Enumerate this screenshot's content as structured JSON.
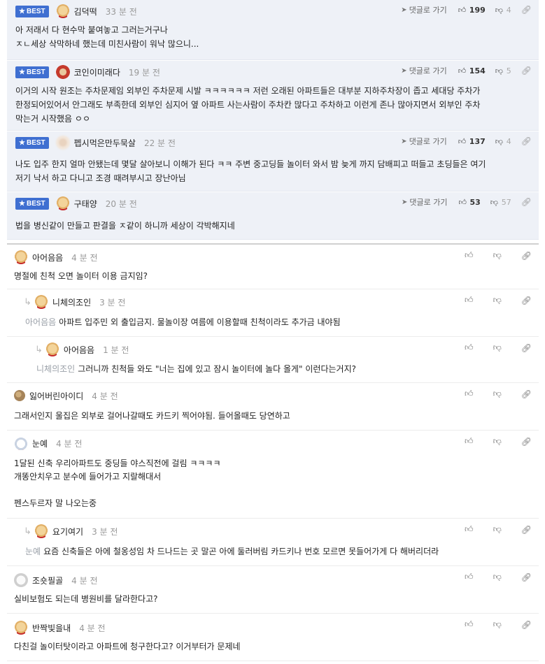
{
  "colors": {
    "best_bg": "#eef1f7",
    "badge": "#3f6fd1"
  },
  "labels": {
    "best": "BEST",
    "go_reply": "댓글로 가기"
  },
  "best_comments": [
    {
      "nick": "김덕떡",
      "time": "33 분 전",
      "likes": "199",
      "dislikes": "4",
      "avatar": "dog-icon",
      "lines": [
        "아 저래서 다 현수막 붙여놓고 그러는거구나",
        "ㅈㄴ세상 삭막하네 했는데 미친사람이 워낙 많으니..."
      ]
    },
    {
      "nick": "코인이미래다",
      "time": "19 분 전",
      "likes": "154",
      "dislikes": "5",
      "avatar": "red-hood-icon",
      "lines": [
        "이거의 시작 원조는 주차문제임 외부인 주차문제 시발 ㅋㅋㅋㅋㅋㅋ 저런 오래된 아파트들은 대부분 지하주차장이 좁고 세대당 주차가",
        "한정되어있어서 안그래도 부족한데 외부인 심지어 옆 아파트 사는사람이 주차칸 많다고 주차하고 이런게 존나 많아지면서 외부인 주차",
        "막는거 시작했음 ㅇㅇ"
      ]
    },
    {
      "nick": "펩시먹은만두묵살",
      "time": "22 분 전",
      "likes": "137",
      "dislikes": "4",
      "avatar": "blurred-avatar-icon",
      "lines": [
        "나도 입주 한지 얼마 안됐는데 몇달 살아보니 이해가 된다 ㅋㅋ 주변 중고딩들 놀이터 와서 밤 늦게 까지 담배피고 떠들고 초딩들은 여기",
        "저기 낙서 하고 다니고 조경 때려부시고 장난아님"
      ]
    },
    {
      "nick": "구태양",
      "time": "20 분 전",
      "likes": "53",
      "dislikes": "57",
      "avatar": "dog-icon",
      "lines": [
        "법을 병신같이 만들고 판결을 ㅈ같이 하니까 세상이 각박해지네"
      ]
    }
  ],
  "comments": [
    {
      "nick": "아어음음",
      "time": "4 분 전",
      "depth": 0,
      "avatar": "dog-icon",
      "mention": "",
      "lines": [
        "명절에 친척 오면 놀이터 이용 금지임?"
      ]
    },
    {
      "nick": "니체의조인",
      "time": "3 분 전",
      "depth": 1,
      "avatar": "dog-icon",
      "mention": "아어음음",
      "lines": [
        "아파트 입주민 외 출입금지. 물놀이장 여름에 이용할때 친척이라도 추가금 내야됨"
      ]
    },
    {
      "nick": "아어음음",
      "time": "1 분 전",
      "depth": 2,
      "avatar": "dog-icon",
      "mention": "니체의조인",
      "lines": [
        "그러니까 친척들 와도 \"너는 집에 있고 잠시 놀이터에 놀다 올게\" 이런다는거지?"
      ]
    },
    {
      "nick": "잃어버린아이디",
      "time": "4 분 전",
      "depth": 0,
      "avatar": "ball-icon",
      "mention": "",
      "lines": [
        "그래서인지 울집은 외부로 걸어나갈때도 카드키 찍어야됨. 들어올때도 당연하고"
      ]
    },
    {
      "nick": "눈예",
      "time": "4 분 전",
      "depth": 0,
      "avatar": "bunny-icon",
      "mention": "",
      "lines": [
        "1달된 신축 우리아파트도 중딩들 야스직전에 걸림 ㅋㅋㅋㅋ",
        "개똥안치우고 분수에 들어가고 지랄해대서",
        "",
        "펜스두르자 말 나오는중"
      ]
    },
    {
      "nick": "요기여기",
      "time": "3 분 전",
      "depth": 1,
      "avatar": "dog-icon",
      "mention": "눈예",
      "lines": [
        "요즘 신축들은 아에 철옹성임 차 드나드는 곳 말곤 아에 둘러버림 카드키나 번호 모르면 못들어가게 다 해버리더라"
      ]
    },
    {
      "nick": "조숏필골",
      "time": "4 분 전",
      "depth": 0,
      "avatar": "white-dog-icon",
      "mention": "",
      "lines": [
        "실비보험도 되는데 병원비를 달라한다고?"
      ]
    },
    {
      "nick": "반짝빛을내",
      "time": "4 분 전",
      "depth": 0,
      "avatar": "dog-icon",
      "mention": "",
      "lines": [
        "다친걸 놀이터탓이라고 아파트에 청구한다고? 이거부터가 문제네"
      ]
    }
  ]
}
